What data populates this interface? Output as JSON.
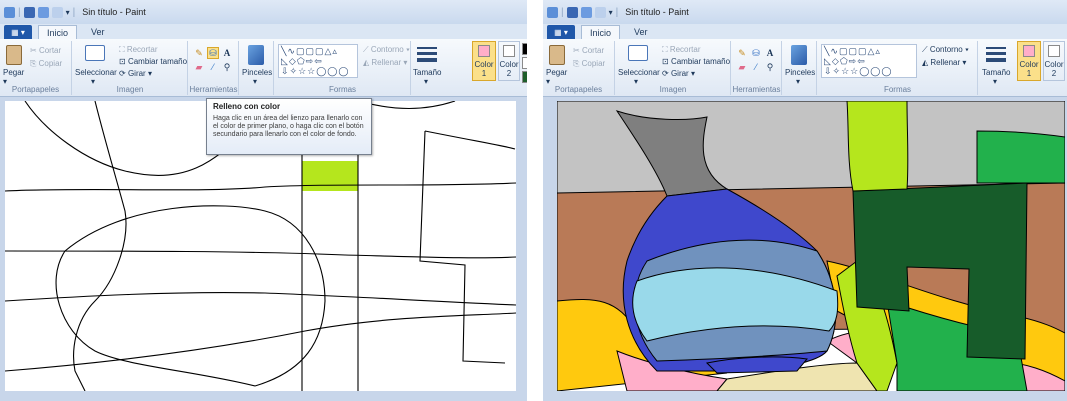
{
  "title": "Sin título - Paint",
  "tabs": {
    "file": "▦ ▾",
    "home": "Inicio",
    "view": "Ver"
  },
  "clipboard": {
    "paste": "Pegar",
    "cut": "Cortar",
    "copy": "Copiar",
    "label": "Portapapeles"
  },
  "image": {
    "select": "Seleccionar",
    "crop": "Recortar",
    "resize": "Cambiar tamaño",
    "rotate": "Girar ▾",
    "label": "Imagen"
  },
  "tools": {
    "label": "Herramientas",
    "brushes": "Pinceles",
    "selected": "fill"
  },
  "shapes": {
    "label": "Formas",
    "outline": "Contorno ▾",
    "fill": "Rellenar ▾",
    "glyphs_row1": "╲∿▢▢▢△▵",
    "glyphs_row2": "◺◇⬠⇨⇦",
    "glyphs_row3": "⇩✧☆☆◯◯◯"
  },
  "size": {
    "label": "Tamaño"
  },
  "colors": {
    "color1": "Color",
    "color1_n": "1",
    "color2": "Color",
    "color2_n": "2",
    "left_color1_hex": "#ffaec9",
    "right_color1_hex": "#ffaec9",
    "color2_hex": "#ffffff"
  },
  "tooltip": {
    "title": "Relleno con color",
    "body": "Haga clic en un área del lienzo para llenarlo con el color de primer plano, o haga clic con el botón secundario para llenarlo con el color de fondo."
  },
  "palette": {
    "black": "#000000",
    "white": "#ffffff",
    "green": "#1e5e2a",
    "lime": "#b5e61d"
  },
  "painting": {
    "gray": "#c3c3c3",
    "darkgray": "#7f7f7f",
    "brown": "#b97a57",
    "blue": "#3f48cc",
    "steel": "#7092be",
    "lightblue": "#99d9ea",
    "yellow": "#ffc90e",
    "pink": "#ffaec9",
    "cream": "#efe4b0",
    "lime": "#b5e61d",
    "green": "#22b14c",
    "darkgreen": "#175c2a"
  }
}
